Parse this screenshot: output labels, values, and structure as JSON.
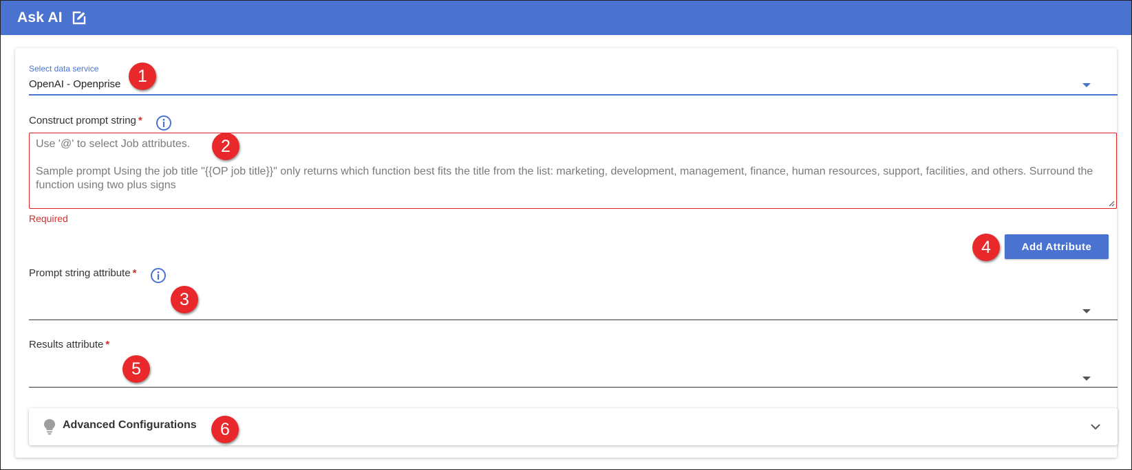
{
  "header": {
    "title": "Ask AI",
    "edit_icon": "edit-icon",
    "background_color": "#4a72d1"
  },
  "data_service": {
    "label": "Select data service",
    "value": "OpenAI - Openprise"
  },
  "prompt": {
    "label": "Construct prompt string",
    "required_mark": "*",
    "placeholder_line1": "Use '@' to select Job attributes.",
    "placeholder_line2": "Sample prompt Using the job title \"{{OP job title}}\" only returns which function best fits the title from the list: marketing, development, management, finance, human resources, support, facilities, and others. Surround the function using two plus signs",
    "error": "Required",
    "info_icon": "info-icon"
  },
  "add_attribute_button": "Add Attribute",
  "prompt_string_attribute": {
    "label": "Prompt string attribute",
    "required_mark": "*",
    "value": ""
  },
  "results_attribute": {
    "label": "Results attribute",
    "required_mark": "*",
    "value": ""
  },
  "advanced": {
    "title": "Advanced Configurations",
    "icon": "lightbulb-icon",
    "chevron": "chevron-down-icon"
  },
  "callouts": [
    "1",
    "2",
    "3",
    "4",
    "5",
    "6"
  ],
  "colors": {
    "accent": "#4a72d1",
    "error": "#d32f2f",
    "callout": "#e8282a"
  }
}
